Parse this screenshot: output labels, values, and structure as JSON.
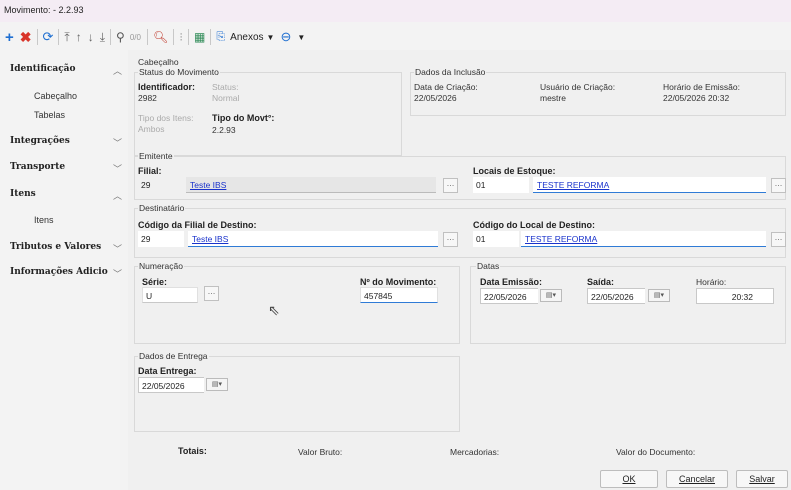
{
  "window": {
    "title": "Movimento:  - 2.2.93"
  },
  "toolbar": {
    "anexos_label": "Anexos",
    "counter": "0/0"
  },
  "sidebar": {
    "items": [
      {
        "label": "Identificação",
        "sub": [
          "Cabeçalho",
          "Tabelas"
        ]
      },
      {
        "label": "Integrações"
      },
      {
        "label": "Transporte"
      },
      {
        "label": "Itens",
        "sub": [
          "Itens"
        ]
      },
      {
        "label": "Tributos e Valores"
      },
      {
        "label": "Informações Adicio"
      }
    ]
  },
  "cabecalho": {
    "title": "Cabeçalho",
    "status_group": {
      "title": "Status do Movimento",
      "identificador_label": "Identificador:",
      "identificador_value": "2982",
      "status_label": "Status:",
      "status_value": "Normal",
      "tipo_itens_label": "Tipo dos Itens:",
      "tipo_itens_value": "Ambos",
      "tipo_mov_label": "Tipo do Movt°:",
      "tipo_mov_value": "2.2.93"
    },
    "inclusao": {
      "title": "Dados da Inclusão",
      "data_criacao_label": "Data de Criação:",
      "data_criacao_value": "22/05/2026",
      "usuario_label": "Usuário de Criação:",
      "usuario_value": "mestre",
      "horario_label": "Horário de Emissão:",
      "horario_value": "22/05/2026 20:32"
    }
  },
  "emitente": {
    "title": "Emitente",
    "filial_label": "Filial:",
    "filial_code": "29",
    "filial_name": "Teste IBS",
    "locais_label": "Locais de Estoque:",
    "locais_code": "01",
    "locais_name": "TESTE REFORMA"
  },
  "destinatario": {
    "title": "Destinatário",
    "filial_label": "Código da Filial de Destino:",
    "filial_code": "29",
    "filial_name": "Teste IBS",
    "local_label": "Código do Local de Destino:",
    "local_code": "01",
    "local_name": "TESTE REFORMA"
  },
  "numeracao": {
    "title": "Numeração",
    "serie_label": "Série:",
    "serie_value": "U",
    "movimento_label": "Nº do Movimento:",
    "movimento_value": "457845"
  },
  "datas": {
    "title": "Datas",
    "emissao_label": "Data Emissão:",
    "emissao_value": "22/05/2026",
    "saida_label": "Saída:",
    "saida_value": "22/05/2026",
    "horario_label": "Horário:",
    "horario_value": "20:32"
  },
  "entrega": {
    "title": "Dados de Entrega",
    "data_label": "Data Entrega:",
    "data_value": "22/05/2026"
  },
  "totais": {
    "label": "Totais:",
    "valor_bruto": "Valor Bruto:",
    "mercadorias": "Mercadorias:",
    "valor_documento": "Valor do Documento:"
  },
  "buttons": {
    "ok": "OK",
    "cancelar": "Cancelar",
    "salvar": "Salvar"
  },
  "colors": {
    "accent": "#1a73e8",
    "link": "#1a33cc",
    "delete": "#d9352a",
    "add": "#1f6fd1"
  }
}
